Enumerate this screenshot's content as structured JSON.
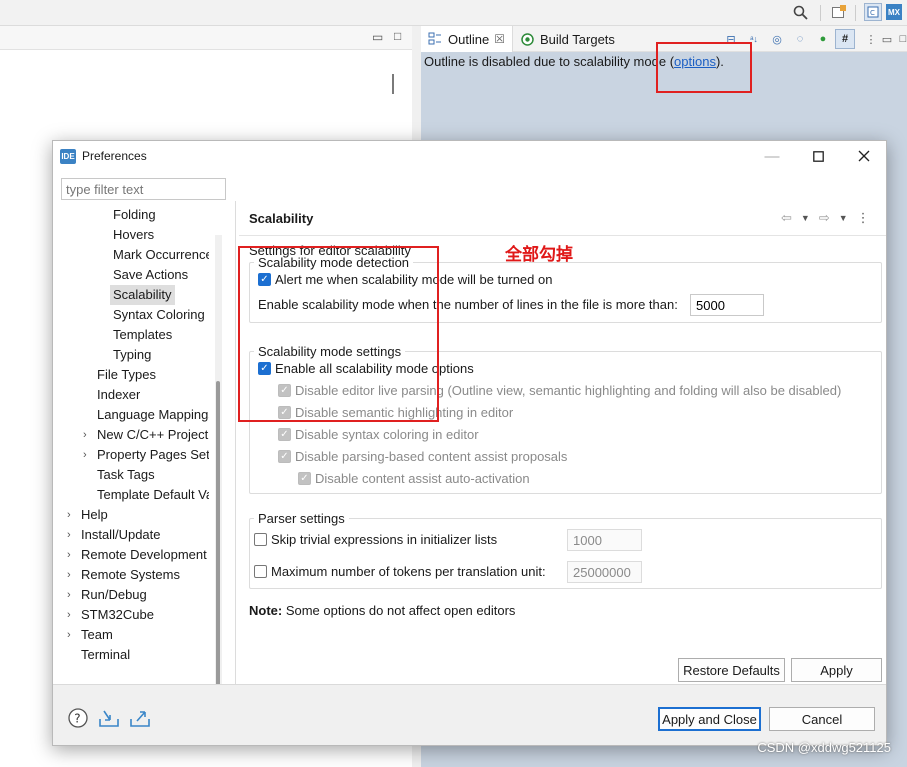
{
  "ide": {
    "outline_tab": "Outline",
    "build_targets_tab": "Build Targets",
    "outline_message_prefix": "Outline is disabled due to scalability mode (",
    "outline_message_link": "options",
    "outline_message_suffix": ")."
  },
  "dialog": {
    "title": "Preferences",
    "logo_text": "IDE",
    "filter_placeholder": "type filter text",
    "tree": [
      {
        "label": "Folding",
        "level": 2
      },
      {
        "label": "Hovers",
        "level": 2
      },
      {
        "label": "Mark Occurrences",
        "level": 2
      },
      {
        "label": "Save Actions",
        "level": 2
      },
      {
        "label": "Scalability",
        "level": 2,
        "selected": true
      },
      {
        "label": "Syntax Coloring",
        "level": 2
      },
      {
        "label": "Templates",
        "level": 2
      },
      {
        "label": "Typing",
        "level": 2
      },
      {
        "label": "File Types",
        "level": 1
      },
      {
        "label": "Indexer",
        "level": 1
      },
      {
        "label": "Language Mappings",
        "level": 1
      },
      {
        "label": "New C/C++ Project Wizard",
        "level": 1,
        "expandable": true
      },
      {
        "label": "Property Pages Settings",
        "level": 1,
        "expandable": true
      },
      {
        "label": "Task Tags",
        "level": 1
      },
      {
        "label": "Template Default Values",
        "level": 1
      },
      {
        "label": "Help",
        "level": 0,
        "expandable": true
      },
      {
        "label": "Install/Update",
        "level": 0,
        "expandable": true
      },
      {
        "label": "Remote Development",
        "level": 0,
        "expandable": true
      },
      {
        "label": "Remote Systems",
        "level": 0,
        "expandable": true
      },
      {
        "label": "Run/Debug",
        "level": 0,
        "expandable": true
      },
      {
        "label": "STM32Cube",
        "level": 0,
        "expandable": true
      },
      {
        "label": "Team",
        "level": 0,
        "expandable": true
      },
      {
        "label": "Terminal",
        "level": 0
      }
    ],
    "page_title": "Scalability",
    "page_description": "Settings for editor scalability",
    "detection_group": {
      "legend": "Scalability mode detection",
      "alert_label": "Alert me when scalability mode will be turned on",
      "alert_checked": true,
      "lines_label": "Enable scalability mode when the number of lines in the file is more than:",
      "lines_value": "5000"
    },
    "settings_group": {
      "legend": "Scalability mode settings",
      "enable_all_label": "Enable all scalability mode options",
      "enable_all_checked": true,
      "options": [
        {
          "label": "Disable editor live parsing (Outline view, semantic highlighting and folding will also be disabled)",
          "checked": true,
          "disabled": true
        },
        {
          "label": "Disable semantic highlighting in editor",
          "checked": true,
          "disabled": true
        },
        {
          "label": "Disable syntax coloring in editor",
          "checked": true,
          "disabled": true
        },
        {
          "label": "Disable parsing-based content assist proposals",
          "checked": true,
          "disabled": true
        },
        {
          "label": "Disable content assist auto-activation",
          "checked": true,
          "disabled": true
        }
      ]
    },
    "parser_group": {
      "legend": "Parser settings",
      "skip_label": "Skip trivial expressions in initializer lists",
      "skip_value": "1000",
      "max_tokens_label": "Maximum number of tokens per translation unit:",
      "max_tokens_value": "25000000"
    },
    "note_bold": "Note:",
    "note_text": " Some options do not affect open editors",
    "restore_defaults": "Restore Defaults",
    "apply": "Apply",
    "apply_and_close": "Apply and Close",
    "cancel": "Cancel"
  },
  "annotation": "全部勾掉",
  "watermark": "CSDN @xddwg521125",
  "colors": {
    "accent": "#1c6fd1",
    "annotation_red": "#e02020",
    "outline_bg": "#c9d4e1"
  }
}
